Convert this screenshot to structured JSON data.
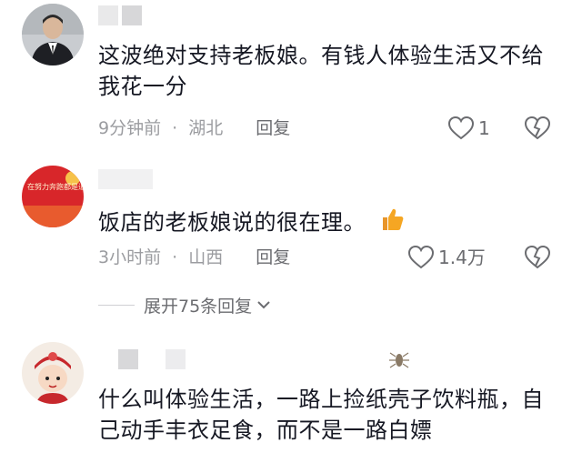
{
  "comments": [
    {
      "text": "这波绝对支持老板娘。有钱人体验生活又不给我花一分",
      "time": "9分钟前",
      "location": "湖北",
      "reply_label": "回复",
      "likes": "1"
    },
    {
      "text": "饭店的老板娘说的很在理。",
      "time": "3小时前",
      "location": "山西",
      "reply_label": "回复",
      "likes": "1.4万",
      "avatar_text": "在努力奔跑都是追梦人"
    },
    {
      "text": "什么叫体验生活，一路上捡纸壳子饮料瓶，自己动手丰衣足食，而不是一路白嫖"
    }
  ],
  "expand_replies": "展开75条回复",
  "separator": "·",
  "icons": {
    "like": "heart-outline-icon",
    "dislike": "broken-heart-icon",
    "thumbs_up": "thumbs-up-emoji",
    "chevron": "chevron-down-icon"
  },
  "colors": {
    "meta": "#9b9ca0",
    "text": "#161823",
    "thumb": "#f5a623"
  }
}
